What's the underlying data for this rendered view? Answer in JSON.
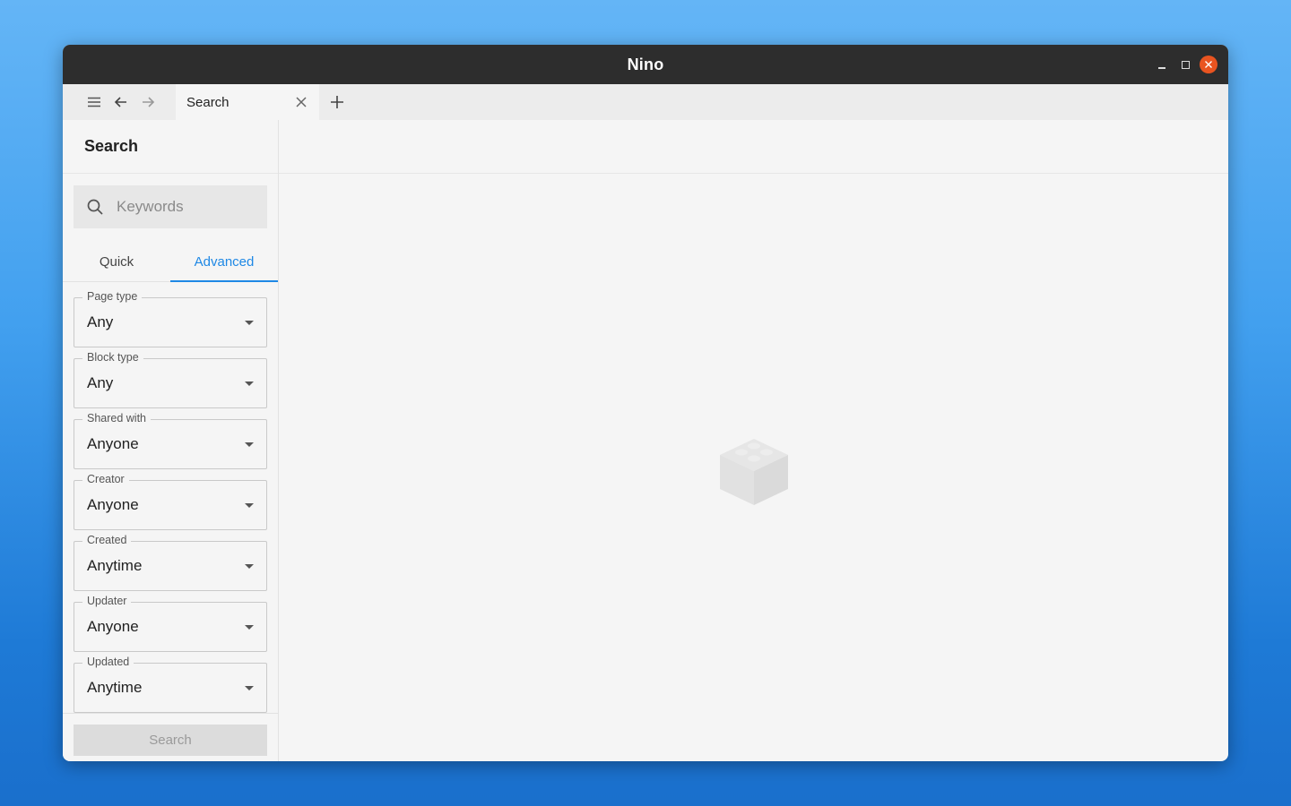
{
  "window": {
    "title": "Nino"
  },
  "tab": {
    "label": "Search"
  },
  "sidebar": {
    "title": "Search",
    "search_placeholder": "Keywords",
    "tabs": [
      {
        "label": "Quick"
      },
      {
        "label": "Advanced"
      }
    ],
    "fields": [
      {
        "label": "Page type",
        "value": "Any"
      },
      {
        "label": "Block type",
        "value": "Any"
      },
      {
        "label": "Shared with",
        "value": "Anyone"
      },
      {
        "label": "Creator",
        "value": "Anyone"
      },
      {
        "label": "Created",
        "value": "Anytime"
      },
      {
        "label": "Updater",
        "value": "Anyone"
      },
      {
        "label": "Updated",
        "value": "Anytime"
      }
    ],
    "search_button": "Search"
  },
  "main": {
    "empty_icon": "brick-icon"
  },
  "colors": {
    "accent": "#1e88e5",
    "close_button": "#e95420",
    "titlebar": "#2d2d2d"
  }
}
